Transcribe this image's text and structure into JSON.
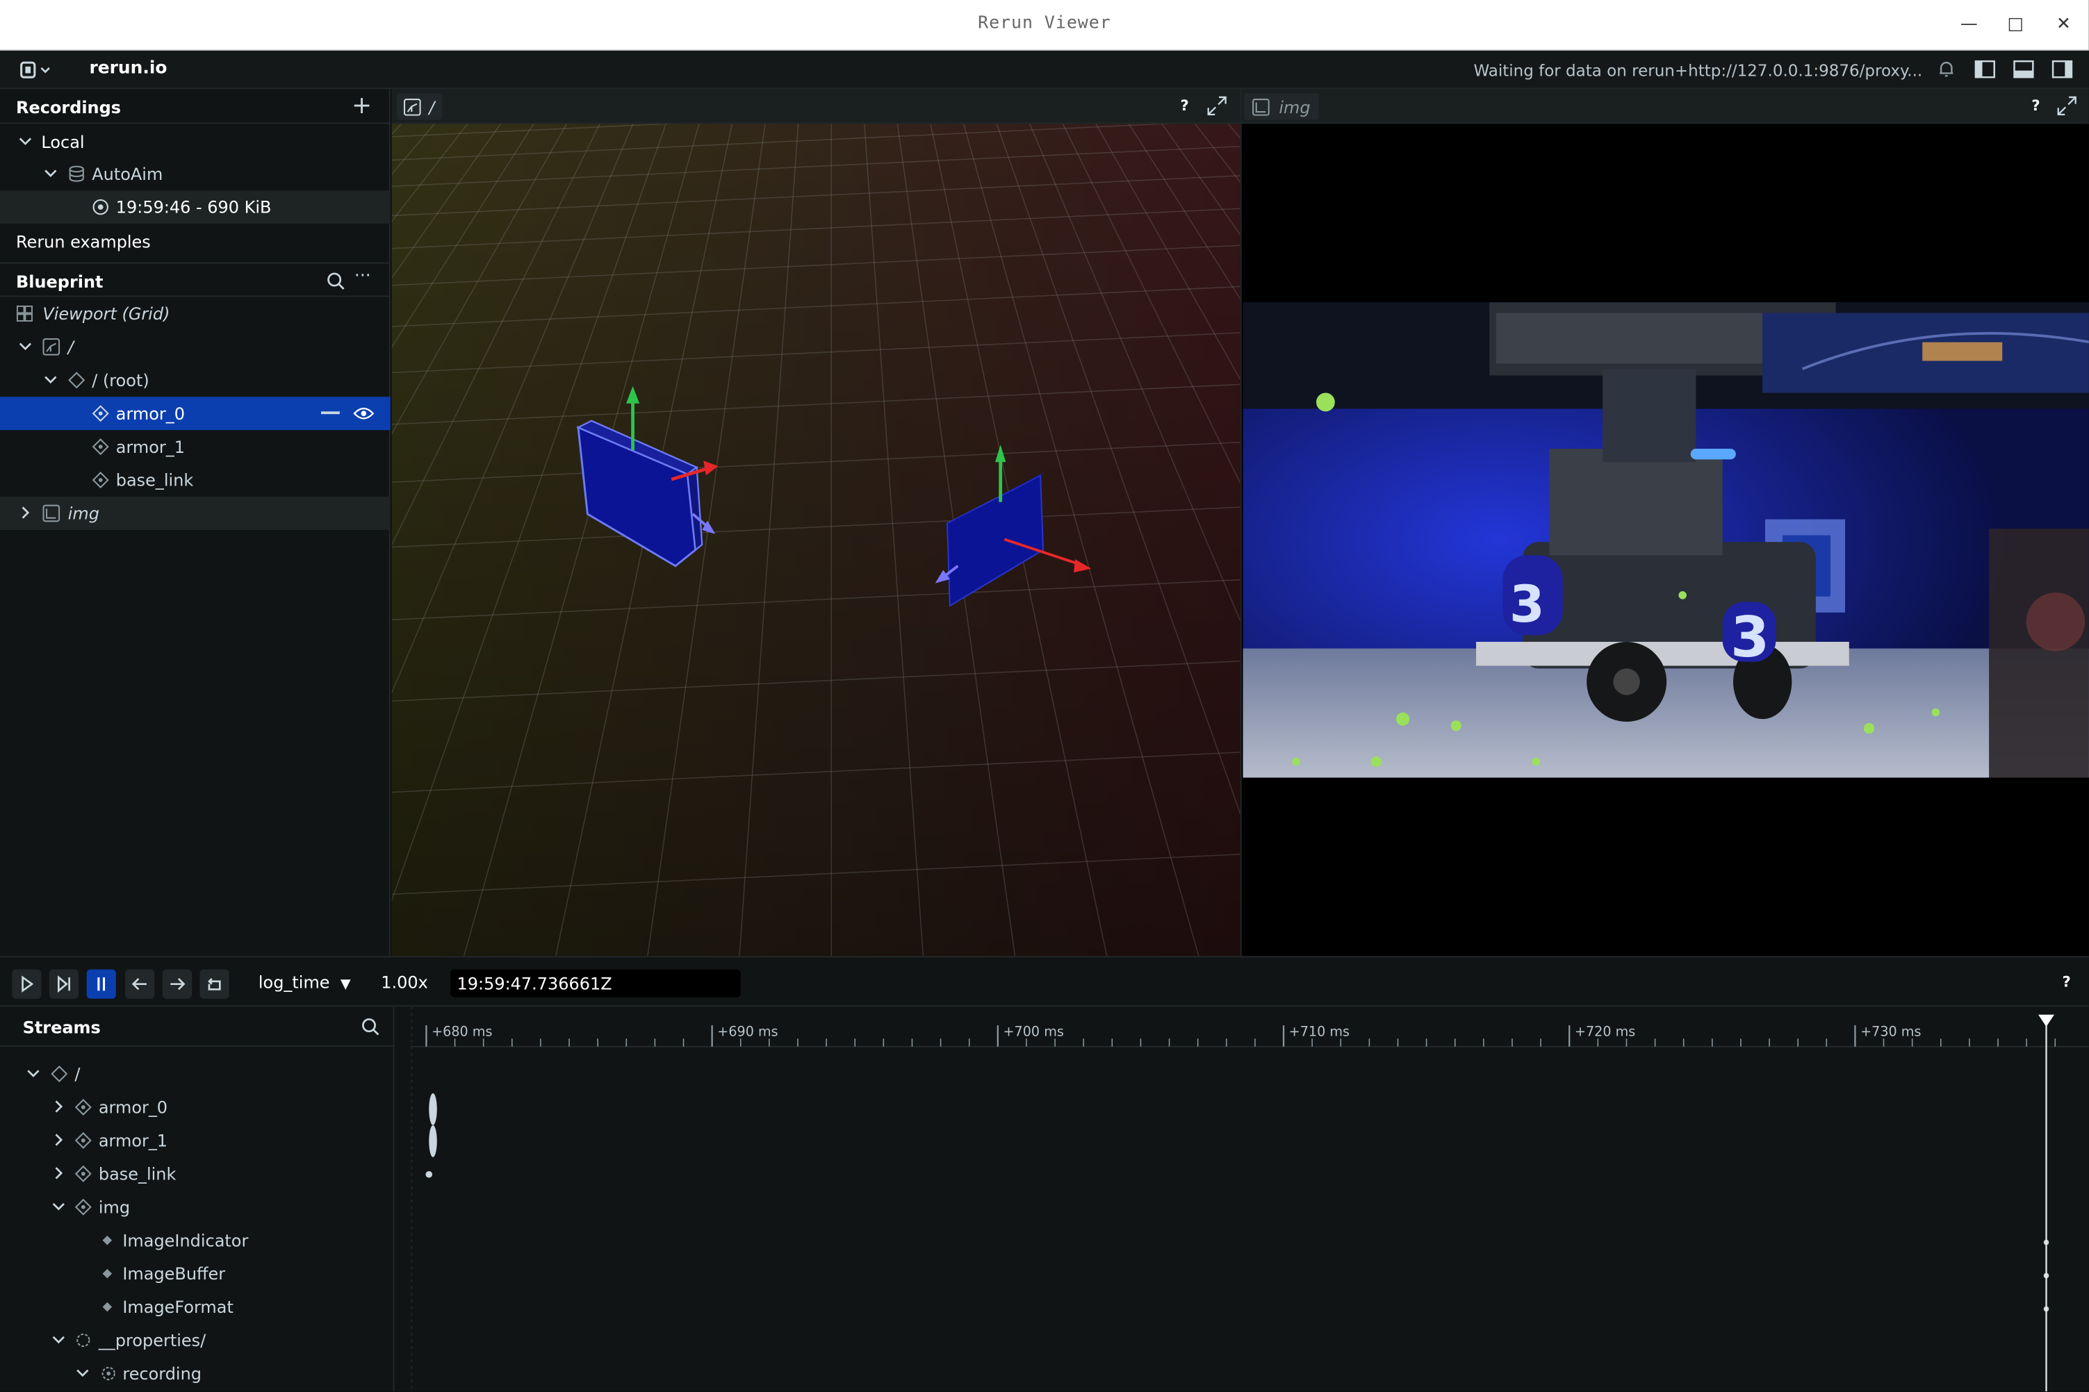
{
  "window": {
    "title": "Rerun Viewer"
  },
  "appbar": {
    "brand": "rerun.io",
    "status": "Waiting for data on rerun+http://127.0.0.1:9876/proxy..."
  },
  "recordings": {
    "header": "Recordings",
    "local_label": "Local",
    "app_name": "AutoAim",
    "recording_entry": "19:59:46 - 690 KiB",
    "examples_label": "Rerun examples"
  },
  "blueprint": {
    "header": "Blueprint",
    "viewport_label": "Viewport (Grid)",
    "view3d_label": "/",
    "root_label": "/ (root)",
    "entities": [
      "armor_0",
      "armor_1",
      "base_link"
    ],
    "img_label": "img"
  },
  "views": {
    "view3d_tab": "/",
    "img_tab": "img",
    "help": "?"
  },
  "timebar": {
    "timeline_name": "log_time",
    "speed": "1.00x",
    "current_time": "19:59:47.736661Z",
    "help": "?"
  },
  "streams": {
    "header": "Streams",
    "root": "/",
    "entities": [
      "armor_0",
      "armor_1",
      "base_link"
    ],
    "img": "img",
    "img_components": [
      "ImageIndicator",
      "ImageBuffer",
      "ImageFormat"
    ],
    "properties": "__properties/",
    "recording": "recording"
  },
  "ruler": {
    "ticks": [
      "+680 ms",
      "+690 ms",
      "+700 ms",
      "+710 ms",
      "+720 ms",
      "+730 ms"
    ]
  },
  "colors": {
    "accent": "#0b3fb0",
    "panel_bg": "#111415",
    "armor_fill": "#0c1496",
    "armor_edge": "#6d7cf2",
    "axis_x": "#e8272a",
    "axis_y": "#2ec44a",
    "axis_z": "#7a78ff"
  }
}
